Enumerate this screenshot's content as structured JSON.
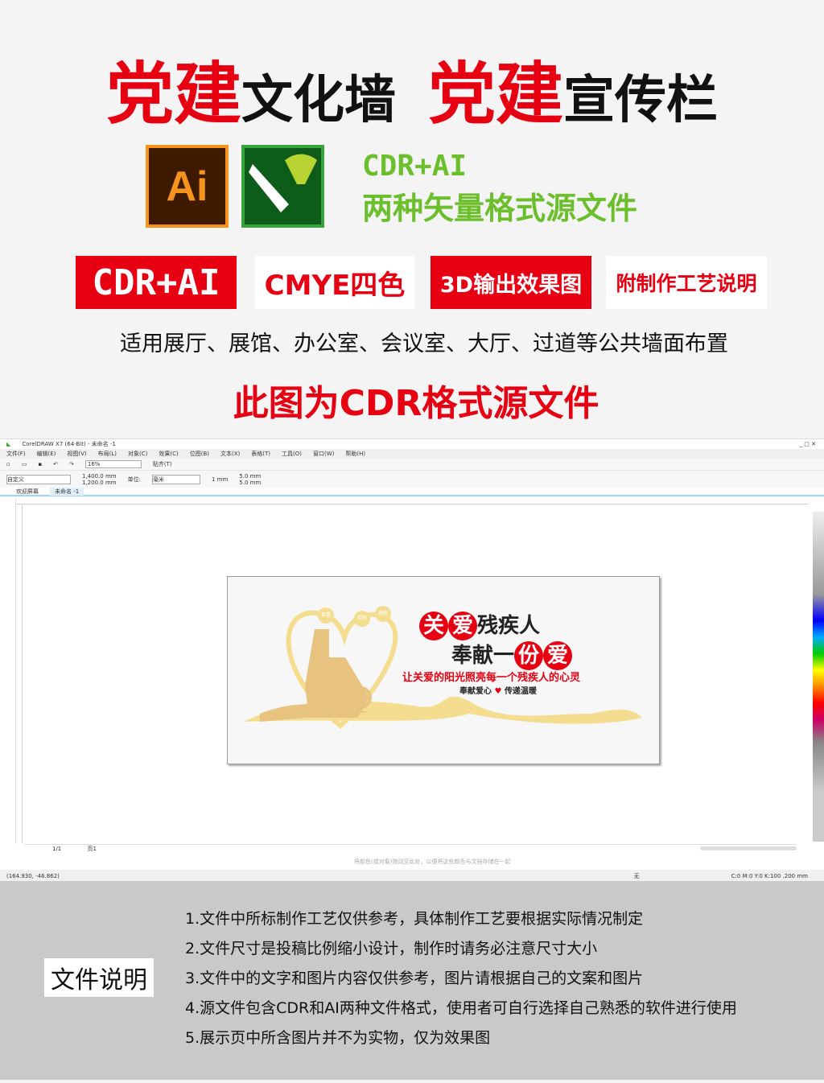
{
  "title": {
    "part1": "党建",
    "part2": "文化墙",
    "part3": "党建",
    "part4": "宣传栏"
  },
  "logos": {
    "ai": "Ai",
    "cdr_icon": "coreldraw-pen-icon"
  },
  "formats": {
    "line1": "CDR+AI",
    "line2": "两种矢量格式源文件"
  },
  "badges": [
    "CDR+AI",
    "CMYE四色",
    "3D输出效果图",
    "附制作工艺说明"
  ],
  "usage": "适用展厅、展馆、办公室、会议室、大厅、过道等公共墙面布置",
  "note": "此图为CDR格式源文件",
  "app": {
    "title": "CorelDRAW X7 (64-Bit) - 未命名 -1",
    "menu": [
      "文件(F)",
      "编辑(E)",
      "视图(V)",
      "布局(L)",
      "对象(C)",
      "效果(C)",
      "位图(B)",
      "文本(X)",
      "表格(T)",
      "工具(O)",
      "窗口(W)",
      "帮助(H)"
    ],
    "zoom": "16%",
    "snap": "贴齐(T)",
    "preset": "自定义",
    "width": "1,400.0 mm",
    "height": "1,200.0 mm",
    "unit_label": "单位:",
    "unit": "毫米",
    "nudge": "1 mm",
    "dup_x": "5.0 mm",
    "dup_y": "5.0 mm",
    "tabs": [
      "欢迎屏幕",
      "未命名 -1"
    ],
    "page_nav": "1/1",
    "page_tab": "页1",
    "coords": "(164.930, -46.862)",
    "color_info": "C:0 M:0 Y:0 K:100 .200 mm",
    "fill_none": "无",
    "hint": "将颜色(或对象)拖动至此处，以便将这些颜色与文档存储在一起"
  },
  "design": {
    "bubbles": [
      "尊重",
      "帮助",
      "理解"
    ],
    "line1_red": [
      "关",
      "爱"
    ],
    "line1_black": "残疾人",
    "line2_black": "奉献一",
    "line2_red": [
      "份",
      "爱"
    ],
    "slogan": "让关爱的阳光照亮每一个残疾人的心灵",
    "sub1": "奉献爱心",
    "sub2": "传递温暖"
  },
  "doc": {
    "label": "文件说明",
    "items": [
      "1.文件中所标制作工艺仅供参考，具体制作工艺要根据实际情况制定",
      "2.文件尺寸是投稿比例缩小设计，制作时请务必注意尺寸大小",
      "3.文件中的文字和图片内容仅供参考，图片请根据自己的文案和图片",
      "4.源文件包含CDR和AI两种文件格式，使用者可自行选择自己熟悉的软件进行使用",
      "5.展示页中所含图片并不为实物，仅为效果图"
    ]
  },
  "colors": {
    "red": "#e60012",
    "green": "#6cbf2c",
    "gold": "#e8c27f"
  }
}
